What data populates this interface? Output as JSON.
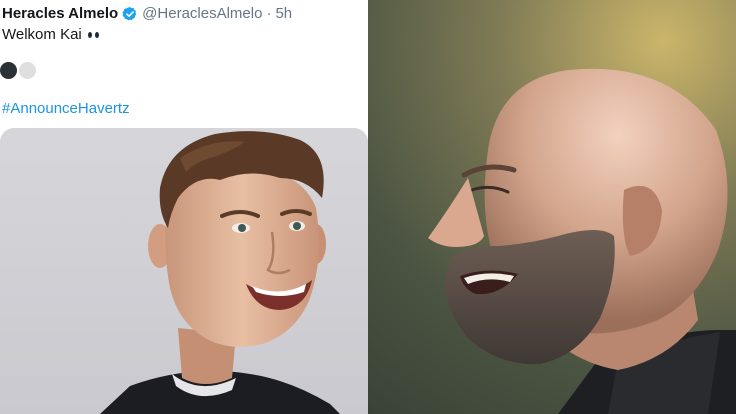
{
  "tweet": {
    "display_name": "Heracles Almelo",
    "handle": "@HeraclesAlmelo",
    "separator": "·",
    "timestamp": "5h",
    "text": "Welkom Kai",
    "hashtag": "#AnnounceHavertz",
    "icons": {
      "verified": "verified-badge-icon",
      "eyes": "eyes-emoji-icon",
      "dark_circle": "black-circle-emoji-icon",
      "light_circle": "white-circle-emoji-icon"
    }
  },
  "colors": {
    "link": "#1b95e0",
    "verified": "#1da1f2",
    "text": "#14171a",
    "secondary_text": "#657786"
  }
}
